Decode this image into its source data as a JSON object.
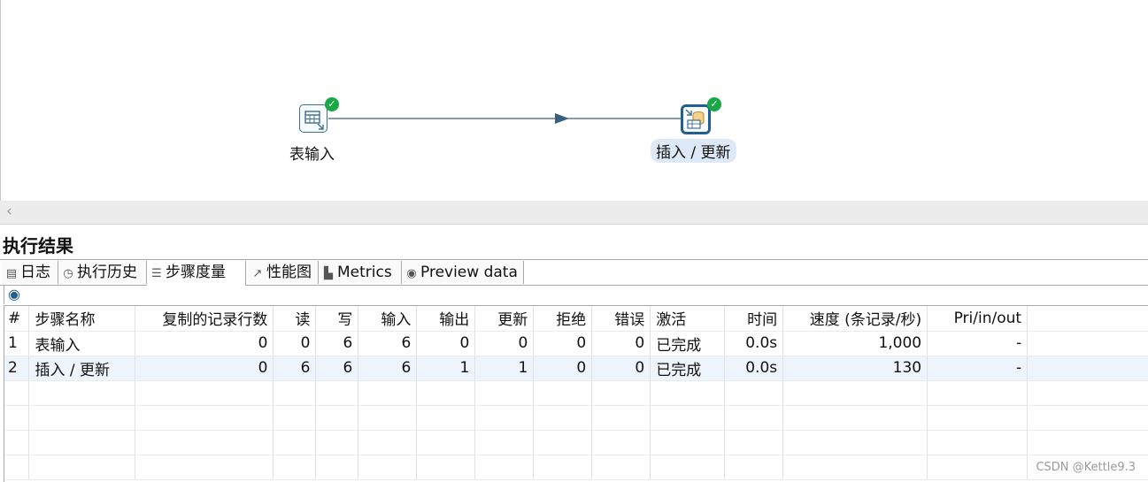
{
  "canvas": {
    "steps": [
      {
        "label": "表输入",
        "status": "ok"
      },
      {
        "label": "插入 / 更新",
        "status": "ok"
      }
    ]
  },
  "results": {
    "title": "执行结果",
    "tabs": [
      {
        "label": "日志",
        "icon": "log-icon"
      },
      {
        "label": "执行历史",
        "icon": "history-icon"
      },
      {
        "label": "步骤度量",
        "icon": "step-metrics-icon",
        "active": true
      },
      {
        "label": "性能图",
        "icon": "perf-chart-icon"
      },
      {
        "label": "Metrics",
        "icon": "metrics-icon"
      },
      {
        "label": "Preview data",
        "icon": "eye-icon"
      }
    ],
    "columns": [
      "#",
      "步骤名称",
      "复制的记录行数",
      "读",
      "写",
      "输入",
      "输出",
      "更新",
      "拒绝",
      "错误",
      "激活",
      "时间",
      "速度 (条记录/秒)",
      "Pri/in/out"
    ],
    "rows": [
      [
        "1",
        "表输入",
        "0",
        "0",
        "6",
        "6",
        "0",
        "0",
        "0",
        "0",
        "已完成",
        "0.0s",
        "1,000",
        "-"
      ],
      [
        "2",
        "插入 / 更新",
        "0",
        "6",
        "6",
        "6",
        "1",
        "1",
        "0",
        "0",
        "已完成",
        "0.0s",
        "130",
        "-"
      ]
    ]
  },
  "watermark": "CSDN @Kettle9.3",
  "colors": {
    "accent": "#1f5f95",
    "ok": "#19a845",
    "hop": "#3b5f7a"
  }
}
